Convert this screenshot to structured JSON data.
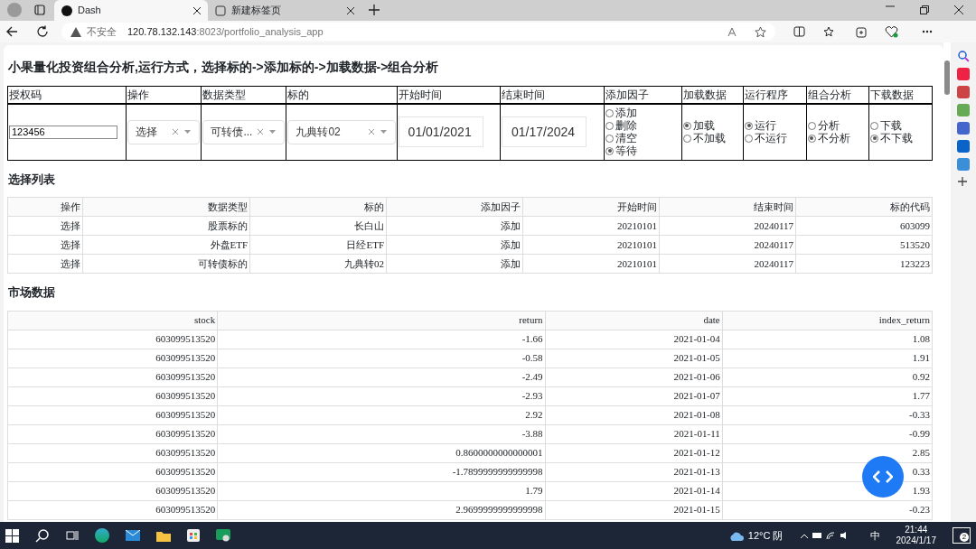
{
  "browser": {
    "tabs": [
      {
        "title": "Dash",
        "selected": true
      },
      {
        "title": "新建标签页",
        "selected": false
      }
    ],
    "address": {
      "security": "不安全",
      "host": "120.78.132.143",
      "path": ":8023/portfolio_analysis_app"
    }
  },
  "page_title": "小果量化投资组合分析,运行方式，选择标的->添加标的->加载数据->组合分析",
  "controls": {
    "columns": [
      "授权码",
      "操作",
      "数据类型",
      "标的",
      "开始时间",
      "结束时间",
      "添加因子",
      "加载数据",
      "运行程序",
      "组合分析",
      "下载数据"
    ],
    "auth_code": "123456",
    "dropdowns": [
      {
        "value": "选择"
      },
      {
        "value": "可转债..."
      },
      {
        "value": "九典转02"
      }
    ],
    "dates": [
      "01/01/2021",
      "01/17/2024"
    ],
    "radio_groups": [
      {
        "options": [
          {
            "label": "添加",
            "selected": false
          },
          {
            "label": "删除",
            "selected": false
          },
          {
            "label": "清空",
            "selected": false
          },
          {
            "label": "等待",
            "selected": true
          }
        ]
      },
      {
        "options": [
          {
            "label": "加载",
            "selected": true
          },
          {
            "label": "不加载",
            "selected": false
          }
        ]
      },
      {
        "options": [
          {
            "label": "运行",
            "selected": true
          },
          {
            "label": "不运行",
            "selected": false
          }
        ]
      },
      {
        "options": [
          {
            "label": "分析",
            "selected": false
          },
          {
            "label": "不分析",
            "selected": true
          }
        ]
      },
      {
        "options": [
          {
            "label": "下载",
            "selected": false
          },
          {
            "label": "不下载",
            "selected": true
          }
        ]
      }
    ]
  },
  "selection_list": {
    "title": "选择列表",
    "columns": [
      "操作",
      "数据类型",
      "标的",
      "添加因子",
      "开始时间",
      "结束时间",
      "标的代码"
    ],
    "rows": [
      [
        "选择",
        "股票标的",
        "长白山",
        "添加",
        "20210101",
        "20240117",
        "603099"
      ],
      [
        "选择",
        "外盘ETF",
        "日经ETF",
        "添加",
        "20210101",
        "20240117",
        "513520"
      ],
      [
        "选择",
        "可转债标的",
        "九典转02",
        "添加",
        "20210101",
        "20240117",
        "123223"
      ]
    ]
  },
  "market_data": {
    "title": "市场数据",
    "columns": [
      "stock",
      "return",
      "date",
      "index_return"
    ],
    "rows": [
      [
        "603099513520",
        "-1.66",
        "2021-01-04",
        "1.08"
      ],
      [
        "603099513520",
        "-0.58",
        "2021-01-05",
        "1.91"
      ],
      [
        "603099513520",
        "-2.49",
        "2021-01-06",
        "0.92"
      ],
      [
        "603099513520",
        "-2.93",
        "2021-01-07",
        "1.77"
      ],
      [
        "603099513520",
        "2.92",
        "2021-01-08",
        "-0.33"
      ],
      [
        "603099513520",
        "-3.88",
        "2021-01-11",
        "-0.99"
      ],
      [
        "603099513520",
        "0.8600000000000001",
        "2021-01-12",
        "2.85"
      ],
      [
        "603099513520",
        "-1.7899999999999998",
        "2021-01-13",
        "0.33"
      ],
      [
        "603099513520",
        "1.79",
        "2021-01-14",
        "1.93"
      ],
      [
        "603099513520",
        "2.9699999999999998",
        "2021-01-15",
        "-0.23"
      ]
    ]
  },
  "taskbar": {
    "weather": "12°C 阴",
    "ime": "中",
    "time": "21:44",
    "date": "2024/1/17",
    "notifications": "2"
  }
}
